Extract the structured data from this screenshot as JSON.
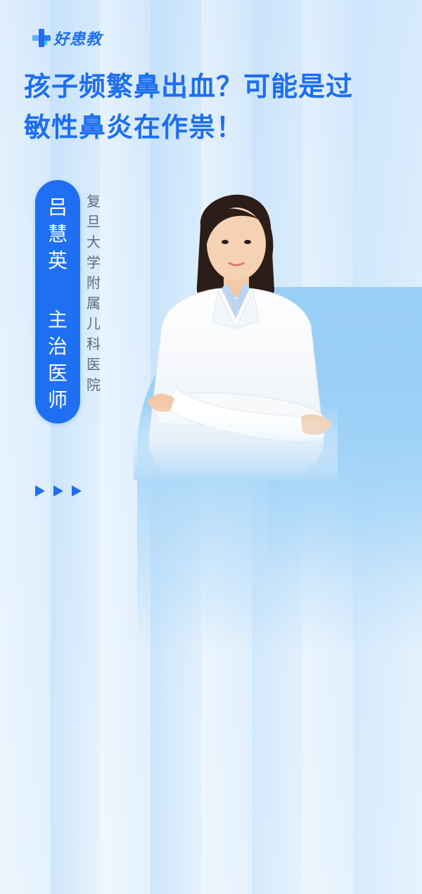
{
  "logo": {
    "text": "好患教",
    "icon": "medical-cross-logo-icon",
    "color": "#1f6ff0"
  },
  "title": "孩子频繁鼻出血？可能是过\n敏性鼻炎在作祟！",
  "doctor": {
    "name_chars": [
      "吕",
      "慧",
      "英"
    ],
    "role_chars": [
      "主",
      "治",
      "医",
      "师"
    ],
    "hospital_chars": [
      "复",
      "旦",
      "大",
      "学",
      "附",
      "属",
      "儿",
      "科",
      "医",
      "院"
    ]
  },
  "decor": {
    "arrows": "triangle-arrows-icon"
  },
  "colors": {
    "accent": "#1e6ff2",
    "title": "#1d6ef3",
    "hospital_text": "#5a6e80"
  }
}
